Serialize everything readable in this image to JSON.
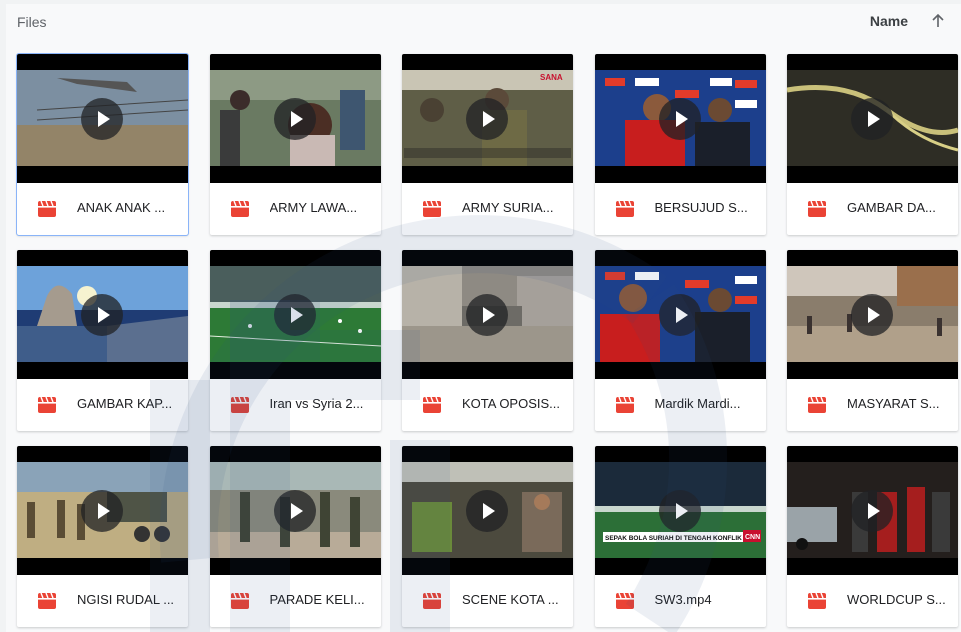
{
  "header": {
    "title": "Files",
    "sort_label": "Name"
  },
  "colors": {
    "video_icon": "#ea4335",
    "accent": "#8ab4f8",
    "watermark": "#2b4e86"
  },
  "files": [
    {
      "name": "ANAK ANAK ...",
      "icon": "video-file-icon",
      "selected": true
    },
    {
      "name": "ARMY LAWA...",
      "icon": "video-file-icon"
    },
    {
      "name": "ARMY SURIA...",
      "icon": "video-file-icon"
    },
    {
      "name": "BERSUJUD S...",
      "icon": "video-file-icon"
    },
    {
      "name": "GAMBAR DA...",
      "icon": "video-file-icon"
    },
    {
      "name": "GAMBAR KAP...",
      "icon": "video-file-icon"
    },
    {
      "name": "Iran vs Syria 2...",
      "icon": "video-file-icon"
    },
    {
      "name": "KOTA OPOSIS...",
      "icon": "video-file-icon"
    },
    {
      "name": "Mardik Mardi...",
      "icon": "video-file-icon"
    },
    {
      "name": "MASYARAT S...",
      "icon": "video-file-icon"
    },
    {
      "name": "NGISI RUDAL ...",
      "icon": "video-file-icon"
    },
    {
      "name": "PARADE KELI...",
      "icon": "video-file-icon"
    },
    {
      "name": "SCENE KOTA ...",
      "icon": "video-file-icon"
    },
    {
      "name": "SW3.mp4",
      "icon": "video-file-icon"
    },
    {
      "name": "WORLDCUP S...",
      "icon": "video-file-icon"
    }
  ],
  "thumbnail_overlays": {
    "sana_logo": "SANA",
    "caption_bar": "SEPAK BOLA SURIAH DI TENGAH KONFLIK",
    "cnn_logo": "CNN"
  }
}
